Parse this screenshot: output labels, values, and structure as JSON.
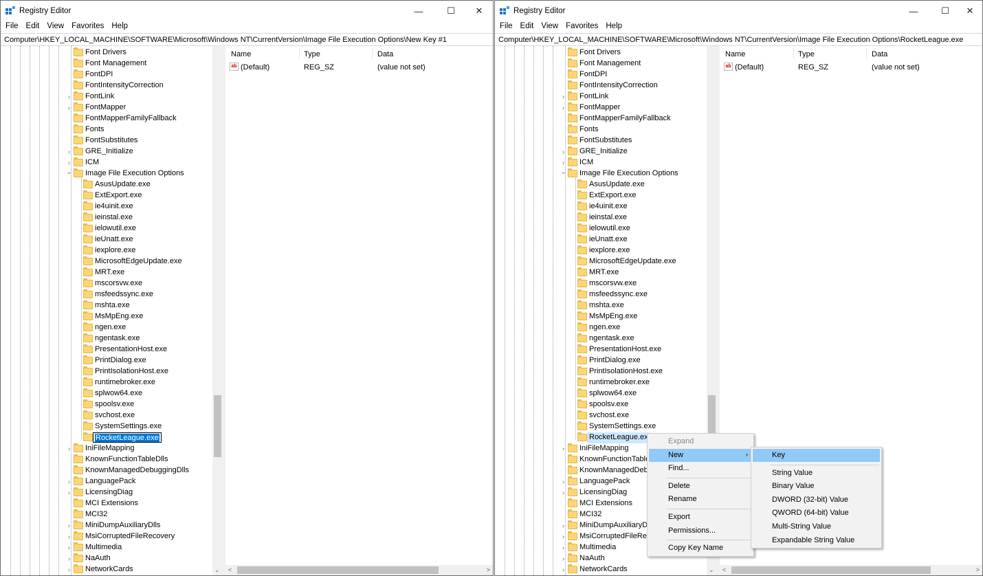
{
  "window_title": "Registry Editor",
  "title_buttons": {
    "minimize": "—",
    "maximize": "☐",
    "close": "✕"
  },
  "menu": [
    "File",
    "Edit",
    "View",
    "Favorites",
    "Help"
  ],
  "left_address": "Computer\\HKEY_LOCAL_MACHINE\\SOFTWARE\\Microsoft\\Windows NT\\CurrentVersion\\Image File Execution Options\\New Key #1",
  "right_address": "Computer\\HKEY_LOCAL_MACHINE\\SOFTWARE\\Microsoft\\Windows NT\\CurrentVersion\\Image File Execution Options\\RocketLeague.exe",
  "columns": {
    "name": "Name",
    "type": "Type",
    "data": "Data"
  },
  "value_row": {
    "icon": "ab",
    "name": "(Default)",
    "type": "REG_SZ",
    "data": "(value not set)"
  },
  "tree_top": [
    {
      "label": "Font Drivers",
      "exp": false
    },
    {
      "label": "Font Management",
      "exp": false
    },
    {
      "label": "FontDPI",
      "exp": false
    },
    {
      "label": "FontIntensityCorrection",
      "exp": false
    },
    {
      "label": "FontLink",
      "exp": true
    },
    {
      "label": "FontMapper",
      "exp": true
    },
    {
      "label": "FontMapperFamilyFallback",
      "exp": false
    },
    {
      "label": "Fonts",
      "exp": false
    },
    {
      "label": "FontSubstitutes",
      "exp": false
    },
    {
      "label": "GRE_Initialize",
      "exp": true
    },
    {
      "label": "ICM",
      "exp": true
    },
    {
      "label": "Image File Execution Options",
      "exp": "open"
    }
  ],
  "tree_children": [
    "AsusUpdate.exe",
    "ExtExport.exe",
    "ie4uinit.exe",
    "ieinstal.exe",
    "ielowutil.exe",
    "ieUnatt.exe",
    "iexplore.exe",
    "MicrosoftEdgeUpdate.exe",
    "MRT.exe",
    "mscorsvw.exe",
    "msfeedssync.exe",
    "mshta.exe",
    "MsMpEng.exe",
    "ngen.exe",
    "ngentask.exe",
    "PresentationHost.exe",
    "PrintDialog.exe",
    "PrintIsolationHost.exe",
    "runtimebroker.exe",
    "splwow64.exe",
    "spoolsv.exe",
    "svchost.exe",
    "SystemSettings.exe"
  ],
  "new_key_name": "RocketLeague.exe",
  "tree_bottom": [
    {
      "label": "IniFileMapping",
      "exp": true
    },
    {
      "label": "KnownFunctionTableDlls",
      "exp": false
    },
    {
      "label": "KnownManagedDebuggingDlls",
      "exp": false
    },
    {
      "label": "LanguagePack",
      "exp": true
    },
    {
      "label": "LicensingDiag",
      "exp": true
    },
    {
      "label": "MCI Extensions",
      "exp": false
    },
    {
      "label": "MCI32",
      "exp": false
    },
    {
      "label": "MiniDumpAuxiliaryDlls",
      "exp": true
    },
    {
      "label": "MsiCorruptedFileRecovery",
      "exp": true
    },
    {
      "label": "Multimedia",
      "exp": true
    },
    {
      "label": "NaAuth",
      "exp": true
    },
    {
      "label": "NetworkCards",
      "exp": true
    }
  ],
  "right_tree_bottom_labels": [
    "IniFileMapping",
    "KnownFunctionTable",
    "KnownManagedDebu",
    "LanguagePack",
    "LicensingDiag",
    "MCI Extensions",
    "MCI32",
    "MiniDumpAuxiliaryD",
    "MsiCorruptedFileRec",
    "Multimedia",
    "NaAuth",
    "NetworkCards"
  ],
  "context_menu": {
    "items": [
      {
        "label": "Expand",
        "disabled": true
      },
      {
        "label": "New",
        "submenu": true,
        "highlight": true
      },
      {
        "label": "Find..."
      },
      {
        "sep": true
      },
      {
        "label": "Delete"
      },
      {
        "label": "Rename"
      },
      {
        "sep": true
      },
      {
        "label": "Export"
      },
      {
        "label": "Permissions..."
      },
      {
        "sep": true
      },
      {
        "label": "Copy Key Name"
      }
    ]
  },
  "submenu": {
    "items": [
      {
        "label": "Key",
        "highlight": true
      },
      {
        "sep": true
      },
      {
        "label": "String Value"
      },
      {
        "label": "Binary Value"
      },
      {
        "label": "DWORD (32-bit) Value"
      },
      {
        "label": "QWORD (64-bit) Value"
      },
      {
        "label": "Multi-String Value"
      },
      {
        "label": "Expandable String Value"
      }
    ]
  }
}
